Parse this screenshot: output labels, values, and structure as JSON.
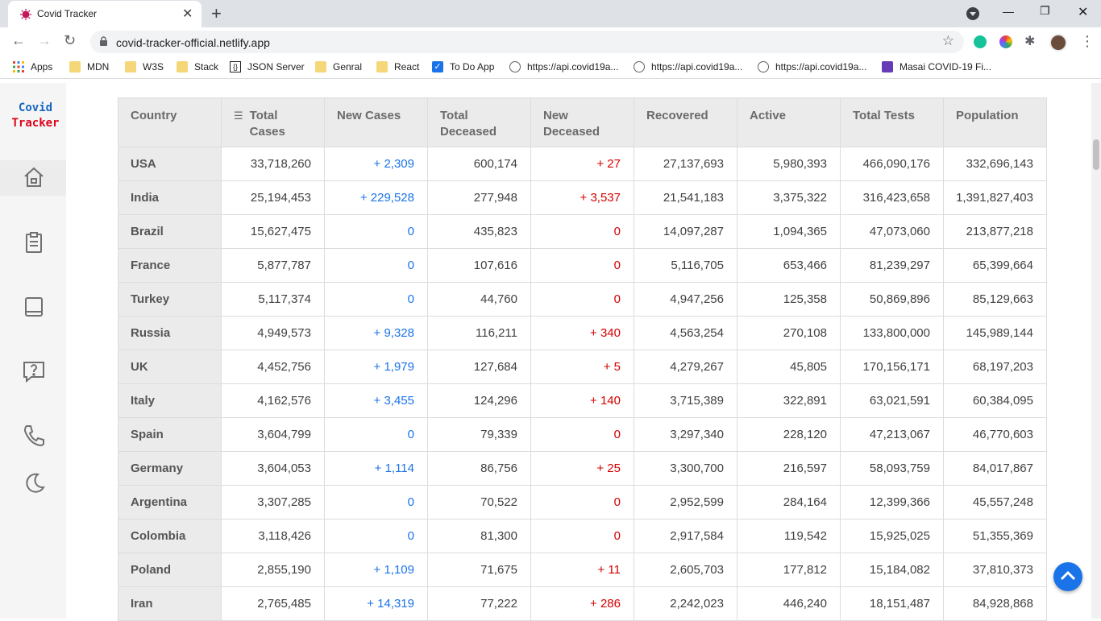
{
  "browser": {
    "tab_title": "Covid Tracker",
    "url": "covid-tracker-official.netlify.app",
    "bookmarks": [
      {
        "label": "Apps",
        "icon": "apps-grid-icon"
      },
      {
        "label": "MDN",
        "icon": "folder-icon"
      },
      {
        "label": "W3S",
        "icon": "folder-icon"
      },
      {
        "label": "Stack",
        "icon": "folder-icon"
      },
      {
        "label": "JSON Server",
        "icon": "json-server-icon"
      },
      {
        "label": "Genral",
        "icon": "folder-icon"
      },
      {
        "label": "React",
        "icon": "folder-icon"
      },
      {
        "label": "To Do App",
        "icon": "checkbox-icon"
      },
      {
        "label": "https://api.covid19a...",
        "icon": "globe-icon"
      },
      {
        "label": "https://api.covid19a...",
        "icon": "globe-icon"
      },
      {
        "label": "https://api.covid19a...",
        "icon": "globe-icon"
      },
      {
        "label": "Masai COVID-19 Fi...",
        "icon": "form-icon"
      }
    ]
  },
  "sidebar": {
    "logo_line1": "Covid",
    "logo_line2": "Tracker",
    "items": [
      "home-icon",
      "clipboard-icon",
      "book-icon",
      "help-icon",
      "phone-icon",
      "moon-icon"
    ]
  },
  "table": {
    "headers": {
      "country": "Country",
      "total_cases_1": "Total",
      "total_cases_2": "Cases",
      "new_cases": "New Cases",
      "total_deceased_1": "Total",
      "total_deceased_2": "Deceased",
      "new_deceased_1": "New",
      "new_deceased_2": "Deceased",
      "recovered": "Recovered",
      "active": "Active",
      "total_tests": "Total Tests",
      "population": "Population"
    },
    "rows": [
      [
        "USA",
        "33,718,260",
        "+ 2,309",
        "600,174",
        "+ 27",
        "27,137,693",
        "5,980,393",
        "466,090,176",
        "332,696,143"
      ],
      [
        "India",
        "25,194,453",
        "+ 229,528",
        "277,948",
        "+ 3,537",
        "21,541,183",
        "3,375,322",
        "316,423,658",
        "1,391,827,403"
      ],
      [
        "Brazil",
        "15,627,475",
        "0",
        "435,823",
        "0",
        "14,097,287",
        "1,094,365",
        "47,073,060",
        "213,877,218"
      ],
      [
        "France",
        "5,877,787",
        "0",
        "107,616",
        "0",
        "5,116,705",
        "653,466",
        "81,239,297",
        "65,399,664"
      ],
      [
        "Turkey",
        "5,117,374",
        "0",
        "44,760",
        "0",
        "4,947,256",
        "125,358",
        "50,869,896",
        "85,129,663"
      ],
      [
        "Russia",
        "4,949,573",
        "+ 9,328",
        "116,211",
        "+ 340",
        "4,563,254",
        "270,108",
        "133,800,000",
        "145,989,144"
      ],
      [
        "UK",
        "4,452,756",
        "+ 1,979",
        "127,684",
        "+ 5",
        "4,279,267",
        "45,805",
        "170,156,171",
        "68,197,203"
      ],
      [
        "Italy",
        "4,162,576",
        "+ 3,455",
        "124,296",
        "+ 140",
        "3,715,389",
        "322,891",
        "63,021,591",
        "60,384,095"
      ],
      [
        "Spain",
        "3,604,799",
        "0",
        "79,339",
        "0",
        "3,297,340",
        "228,120",
        "47,213,067",
        "46,770,603"
      ],
      [
        "Germany",
        "3,604,053",
        "+ 1,114",
        "86,756",
        "+ 25",
        "3,300,700",
        "216,597",
        "58,093,759",
        "84,017,867"
      ],
      [
        "Argentina",
        "3,307,285",
        "0",
        "70,522",
        "0",
        "2,952,599",
        "284,164",
        "12,399,366",
        "45,557,248"
      ],
      [
        "Colombia",
        "3,118,426",
        "0",
        "81,300",
        "0",
        "2,917,584",
        "119,542",
        "15,925,025",
        "51,355,369"
      ],
      [
        "Poland",
        "2,855,190",
        "+ 1,109",
        "71,675",
        "+ 11",
        "2,605,703",
        "177,812",
        "15,184,082",
        "37,810,373"
      ],
      [
        "Iran",
        "2,765,485",
        "+ 14,319",
        "77,222",
        "+ 286",
        "2,242,023",
        "446,240",
        "18,151,487",
        "84,928,868"
      ]
    ]
  },
  "colors": {
    "new_cases": "#1a73e8",
    "new_deceased": "#d50000",
    "logo_blue": "#1565c0",
    "logo_red": "#e0001b",
    "scroll_top_button": "#1a73e8"
  }
}
